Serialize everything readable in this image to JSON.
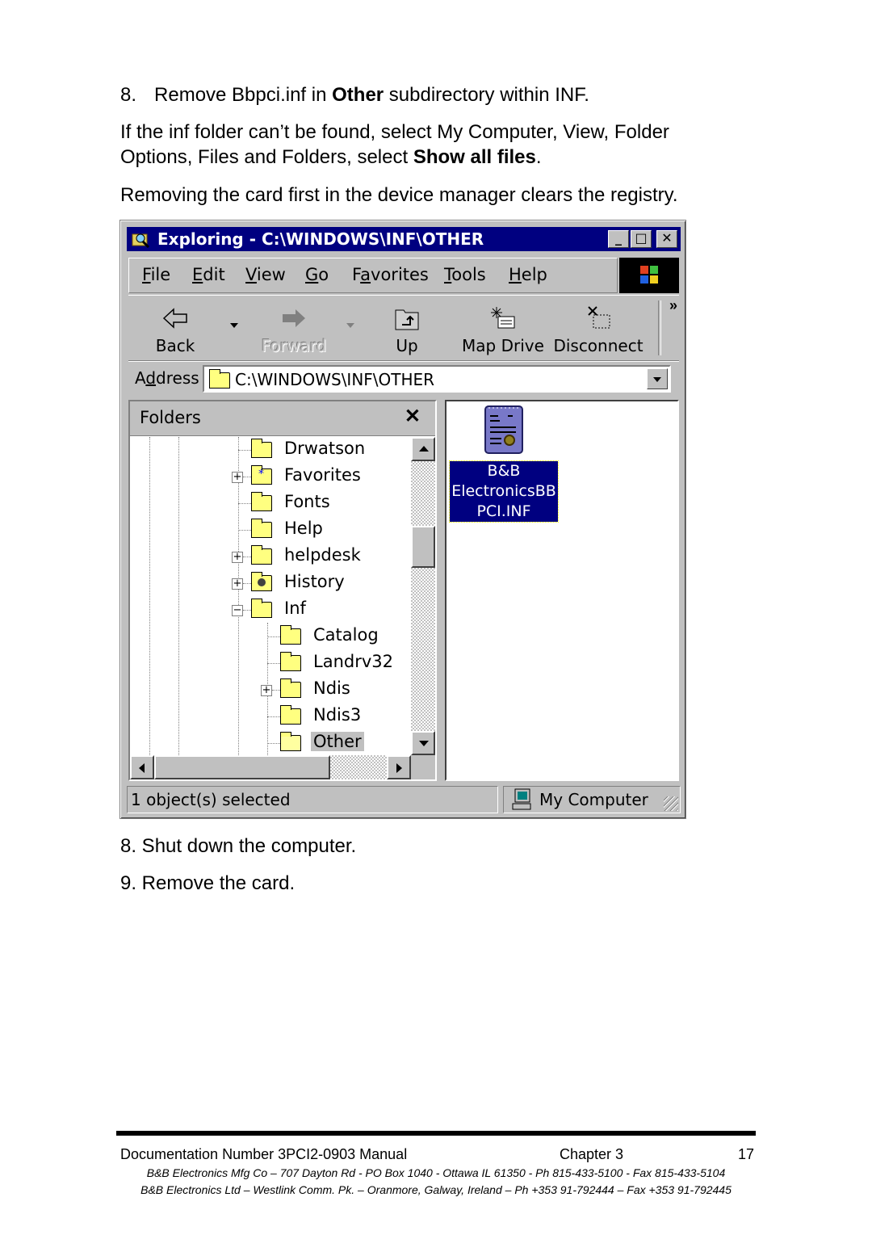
{
  "document": {
    "step8_prefix": "8.",
    "step8_text_before": "Remove Bbpci.inf in ",
    "step8_bold": "Other",
    "step8_text_after": " subdirectory within INF.",
    "para_line1": "If the inf folder can’t be found, select My Computer, View, Folder",
    "para_line2_before": "Options, Files and Folders, select ",
    "para_line2_bold": "Show all files",
    "para_line2_after": ".",
    "para_registry": "Removing the card first in the device manager clears the registry.",
    "step_shutdown": "8. Shut down the computer.",
    "step_remove": "9. Remove the card."
  },
  "window": {
    "title": "Exploring - C:\\WINDOWS\\INF\\OTHER",
    "title_icon": "exploring-icon",
    "controls": {
      "minimize": "_",
      "maximize": "□",
      "close": "✕"
    },
    "menu": [
      {
        "label": "File",
        "ul": "F",
        "rest": "ile"
      },
      {
        "label": "Edit",
        "ul": "E",
        "rest": "dit"
      },
      {
        "label": "View",
        "ul": "V",
        "rest": "iew"
      },
      {
        "label": "Go",
        "ul": "G",
        "rest": "o"
      },
      {
        "label": "Favorites",
        "pre": "F",
        "ul": "a",
        "rest": "vorites"
      },
      {
        "label": "Tools",
        "ul": "T",
        "rest": "ools"
      },
      {
        "label": "Help",
        "ul": "H",
        "rest": "elp"
      }
    ],
    "toolbar": {
      "back": "Back",
      "forward": "Forward",
      "up": "Up",
      "map_drive": "Map Drive",
      "disconnect": "Disconnect",
      "more": "»"
    },
    "address": {
      "label_pre": "A",
      "label_ul": "d",
      "label_rest": "dress",
      "value": "C:\\WINDOWS\\INF\\OTHER"
    },
    "folders_pane": {
      "title": "Folders",
      "close": "✕",
      "tree": [
        {
          "name": "Drwatson",
          "level": 0,
          "expander": ""
        },
        {
          "name": "Favorites",
          "level": 0,
          "expander": "+"
        },
        {
          "name": "Fonts",
          "level": 0,
          "expander": ""
        },
        {
          "name": "Help",
          "level": 0,
          "expander": ""
        },
        {
          "name": "helpdesk",
          "level": 0,
          "expander": "+"
        },
        {
          "name": "History",
          "level": 0,
          "expander": "+"
        },
        {
          "name": "Inf",
          "level": 0,
          "expander": "−"
        },
        {
          "name": "Catalog",
          "level": 1,
          "expander": ""
        },
        {
          "name": "Landrv32",
          "level": 1,
          "expander": ""
        },
        {
          "name": "Ndis",
          "level": 1,
          "expander": "+"
        },
        {
          "name": "Ndis3",
          "level": 1,
          "expander": ""
        },
        {
          "name": "Other",
          "level": 1,
          "expander": "",
          "selected": true
        }
      ]
    },
    "content": {
      "file_line1": "B&B",
      "file_line2": "ElectronicsBB",
      "file_line3": "PCI.INF",
      "selected": true
    },
    "status": {
      "left": "1 object(s) selected",
      "right": "My Computer"
    },
    "colors": {
      "title_bar": "#000080",
      "face": "#c0c0c0",
      "selection": "#000080",
      "folder": "#ffff80"
    }
  },
  "footer": {
    "doc_number": "Documentation Number 3PCI2-0903 Manual",
    "chapter": "Chapter 3",
    "page": "17",
    "address_us": "B&B Electronics Mfg Co – 707 Dayton Rd - PO Box 1040 - Ottawa IL 61350 - Ph 815-433-5100 - Fax 815-433-5104",
    "address_ie": "B&B Electronics Ltd – Westlink Comm. Pk. – Oranmore, Galway, Ireland – Ph +353 91-792444 – Fax +353 91-792445"
  }
}
